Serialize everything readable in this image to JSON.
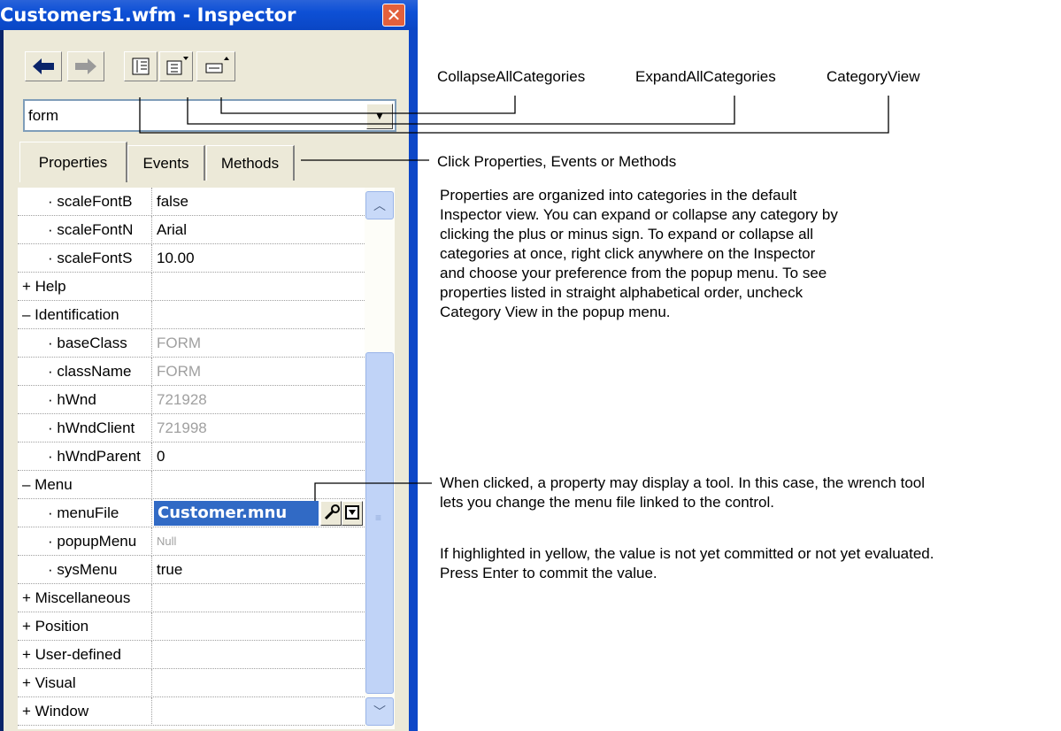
{
  "window": {
    "title": "Customers1.wfm - Inspector",
    "close_symbol": "✕",
    "accent": "#0a46c4"
  },
  "toolbar": {
    "back_icon": "left-arrow-icon",
    "forward_icon": "right-arrow-icon",
    "category_view_icon": "category-view-icon",
    "expand_all_icon": "expand-all-icon",
    "collapse_all_icon": "collapse-all-icon"
  },
  "object_combo": {
    "value": "form",
    "arrow": "▼"
  },
  "tabs": [
    {
      "label": "Properties",
      "active": true
    },
    {
      "label": "Events",
      "active": false
    },
    {
      "label": "Methods",
      "active": false
    }
  ],
  "grid": {
    "rows": [
      {
        "name": "· scaleFontB",
        "value": "false",
        "readonly": false
      },
      {
        "name": "· scaleFontN",
        "value": "Arial",
        "readonly": false
      },
      {
        "name": "· scaleFontS",
        "value": "10.00",
        "readonly": false
      },
      {
        "name": "+ Help",
        "value": "",
        "readonly": false
      },
      {
        "name": "– Identification",
        "value": "",
        "readonly": false
      },
      {
        "name": "· baseClass",
        "value": "FORM",
        "readonly": true
      },
      {
        "name": "· className",
        "value": "FORM",
        "readonly": true
      },
      {
        "name": "· hWnd",
        "value": "721928",
        "readonly": true
      },
      {
        "name": "· hWndClient",
        "value": "721998",
        "readonly": true
      },
      {
        "name": "· hWndParent",
        "value": "0",
        "readonly": false
      },
      {
        "name": "– Menu",
        "value": "",
        "readonly": false
      },
      {
        "name": "· menuFile",
        "value": "Customer.mnu",
        "readonly": false,
        "selected": true
      },
      {
        "name": "· popupMenu",
        "value": "Null",
        "readonly": true
      },
      {
        "name": "· sysMenu",
        "value": "true",
        "readonly": false
      },
      {
        "name": "+ Miscellaneous",
        "value": "",
        "readonly": false
      },
      {
        "name": "+ Position",
        "value": "",
        "readonly": false
      },
      {
        "name": "+ User-defined",
        "value": "",
        "readonly": false
      },
      {
        "name": "+ Visual",
        "value": "",
        "readonly": false
      },
      {
        "name": "+ Window",
        "value": "",
        "readonly": false
      }
    ],
    "wrench_icon": "wrench-icon",
    "dropdown_icon": "down-arrow-icon"
  },
  "scrollbar": {
    "up": "︿",
    "down": "﹀"
  },
  "annotations": {
    "collapse_all": "CollapseAllCategories",
    "expand_all": "ExpandAllCategories",
    "category_view": "CategoryView",
    "tabs_hint": "Click Properties, Events or Methods",
    "categories_para": [
      "Properties are organized into categories in the default",
      "Inspector view. You can expand or collapse any category by",
      "clicking the plus or minus sign. To expand or collapse all",
      "categories at once, right click anywhere on the Inspector",
      "and choose your preference from the popup menu. To see",
      "properties listed in straight alphabetical order, uncheck",
      "Category View in the popup menu."
    ],
    "tool_para": [
      "When clicked, a property may display a tool. In this case, the wrench tool",
      "lets you change the menu file linked to the control."
    ],
    "yellow_para": [
      "If highlighted in yellow, the value is not yet committed or not yet evaluated.",
      "Press Enter to commit the value."
    ]
  }
}
